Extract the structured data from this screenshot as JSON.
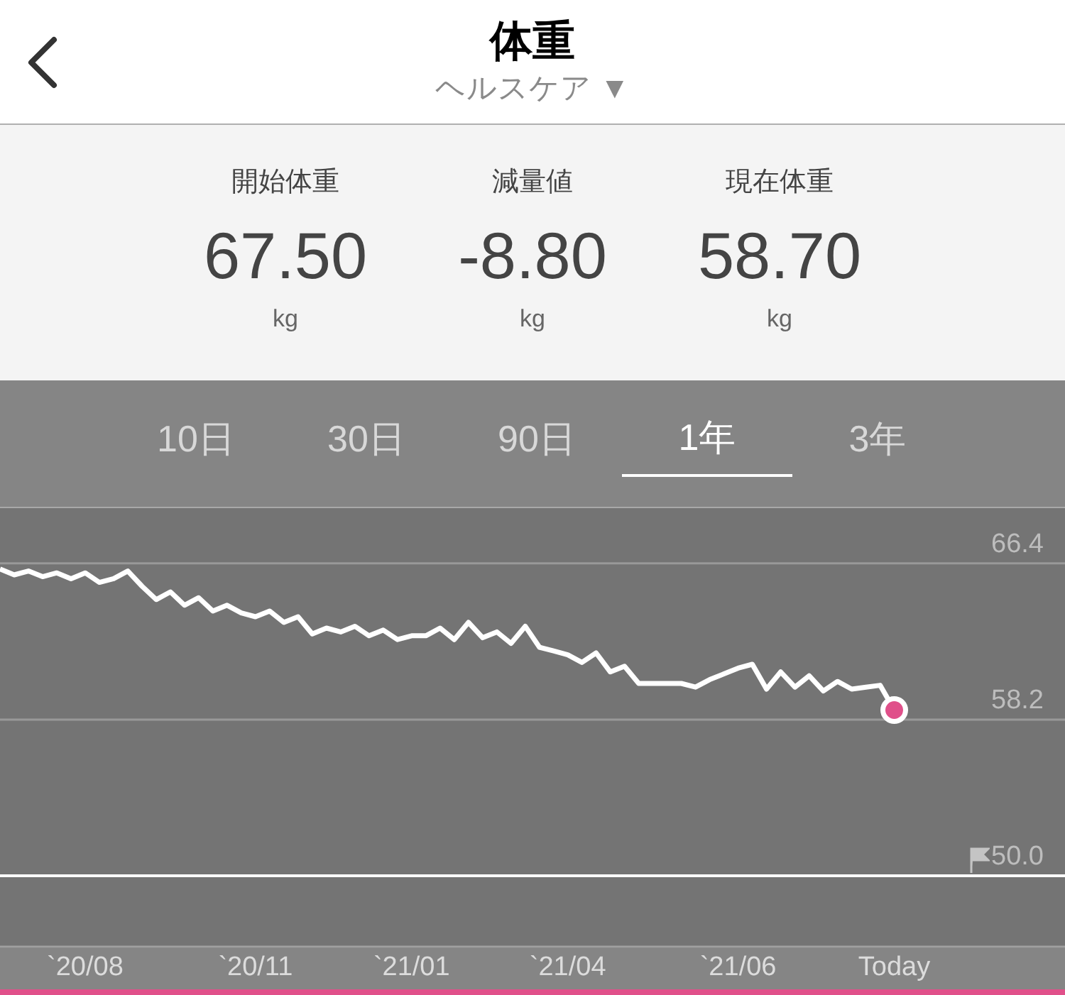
{
  "header": {
    "title": "体重",
    "subtitle": "ヘルスケア ▼"
  },
  "stats": [
    {
      "label": "開始体重",
      "value": "67.50",
      "unit": "kg"
    },
    {
      "label": "減量値",
      "value": "-8.80",
      "unit": "kg"
    },
    {
      "label": "現在体重",
      "value": "58.70",
      "unit": "kg"
    }
  ],
  "tabs": [
    {
      "label": "10日",
      "selected": false
    },
    {
      "label": "30日",
      "selected": false
    },
    {
      "label": "90日",
      "selected": false
    },
    {
      "label": "1年",
      "selected": true
    },
    {
      "label": "3年",
      "selected": false
    }
  ],
  "chart": {
    "chart_data": {
      "type": "line",
      "ylim": [
        50,
        69.3
      ],
      "yticks": [
        {
          "value": 66.4,
          "label": "66.4"
        },
        {
          "value": 58.2,
          "label": "58.2"
        },
        {
          "value": 50.0,
          "label": "50.0"
        }
      ],
      "categories": [
        null,
        null,
        null,
        null,
        null,
        null,
        "`20/08",
        null,
        null,
        null,
        null,
        null,
        null,
        null,
        null,
        null,
        null,
        null,
        "`20/11",
        null,
        null,
        null,
        null,
        null,
        null,
        null,
        null,
        null,
        null,
        "`21/01",
        null,
        null,
        null,
        null,
        null,
        null,
        null,
        null,
        null,
        null,
        "`21/04",
        null,
        null,
        null,
        null,
        null,
        null,
        null,
        null,
        null,
        null,
        null,
        "`21/06",
        null,
        null,
        null,
        null,
        null,
        null,
        null,
        null,
        null,
        null,
        "Today"
      ],
      "series": [
        {
          "color": "#ffffff",
          "values": [
            66.1,
            65.8,
            66.0,
            65.7,
            65.9,
            65.6,
            65.9,
            65.4,
            65.6,
            66.0,
            65.2,
            64.5,
            64.9,
            64.2,
            64.6,
            63.9,
            64.2,
            63.8,
            63.6,
            63.9,
            63.3,
            63.6,
            62.7,
            63.0,
            62.8,
            63.1,
            62.6,
            62.9,
            62.4,
            62.6,
            62.6,
            63.0,
            62.4,
            63.3,
            62.5,
            62.8,
            62.2,
            63.1,
            62.0,
            61.8,
            61.6,
            61.2,
            61.7,
            60.7,
            61.0,
            60.1,
            60.1,
            60.1,
            60.1,
            59.9,
            60.3,
            60.6,
            60.9,
            61.1,
            59.8,
            60.7,
            59.9,
            60.5,
            59.7,
            60.2,
            59.8,
            59.9,
            60.0,
            58.7
          ]
        }
      ]
    }
  }
}
